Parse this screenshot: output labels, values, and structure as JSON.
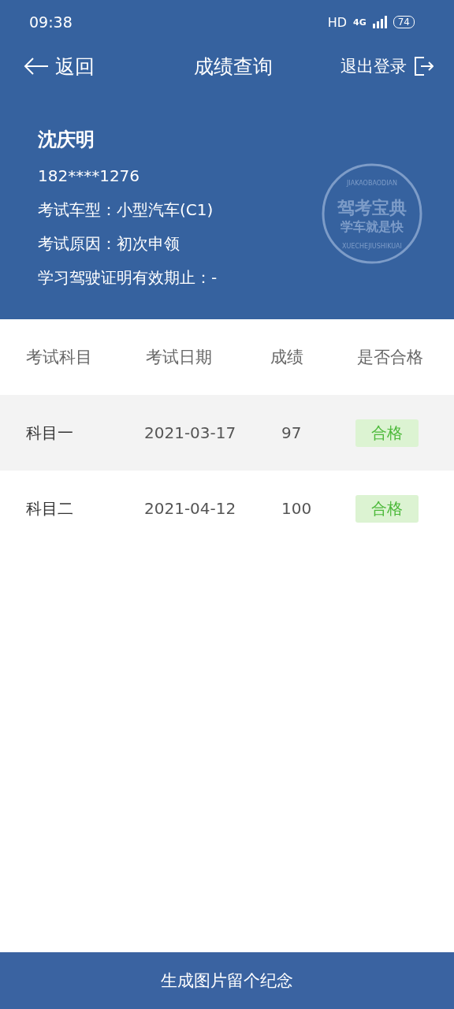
{
  "status_bar": {
    "time": "09:38",
    "hd": "HD",
    "network": "4G",
    "battery": "74"
  },
  "nav": {
    "back": "返回",
    "title": "成绩查询",
    "logout": "退出登录"
  },
  "profile": {
    "name": "沈庆明",
    "phone": "182****1276",
    "lines": [
      "考试车型：小型汽车(C1)",
      "考试原因：初次申领",
      "学习驾驶证明有效期止：-"
    ]
  },
  "stamp": {
    "top": "JIAKAOBAODIAN",
    "title": "驾考宝典",
    "slogan": "学车就是快",
    "bottom": "XUECHEJIUSHIKUAI"
  },
  "table": {
    "columns": [
      "考试科目",
      "考试日期",
      "成绩",
      "是否合格"
    ],
    "rows": [
      {
        "subject": "科目一",
        "date": "2021-03-17",
        "score": "97",
        "result": "合格",
        "passed": true,
        "shaded": true
      },
      {
        "subject": "科目二",
        "date": "2021-04-12",
        "score": "100",
        "result": "合格",
        "passed": true,
        "shaded": false
      }
    ]
  },
  "bottom_button": "生成图片留个纪念"
}
